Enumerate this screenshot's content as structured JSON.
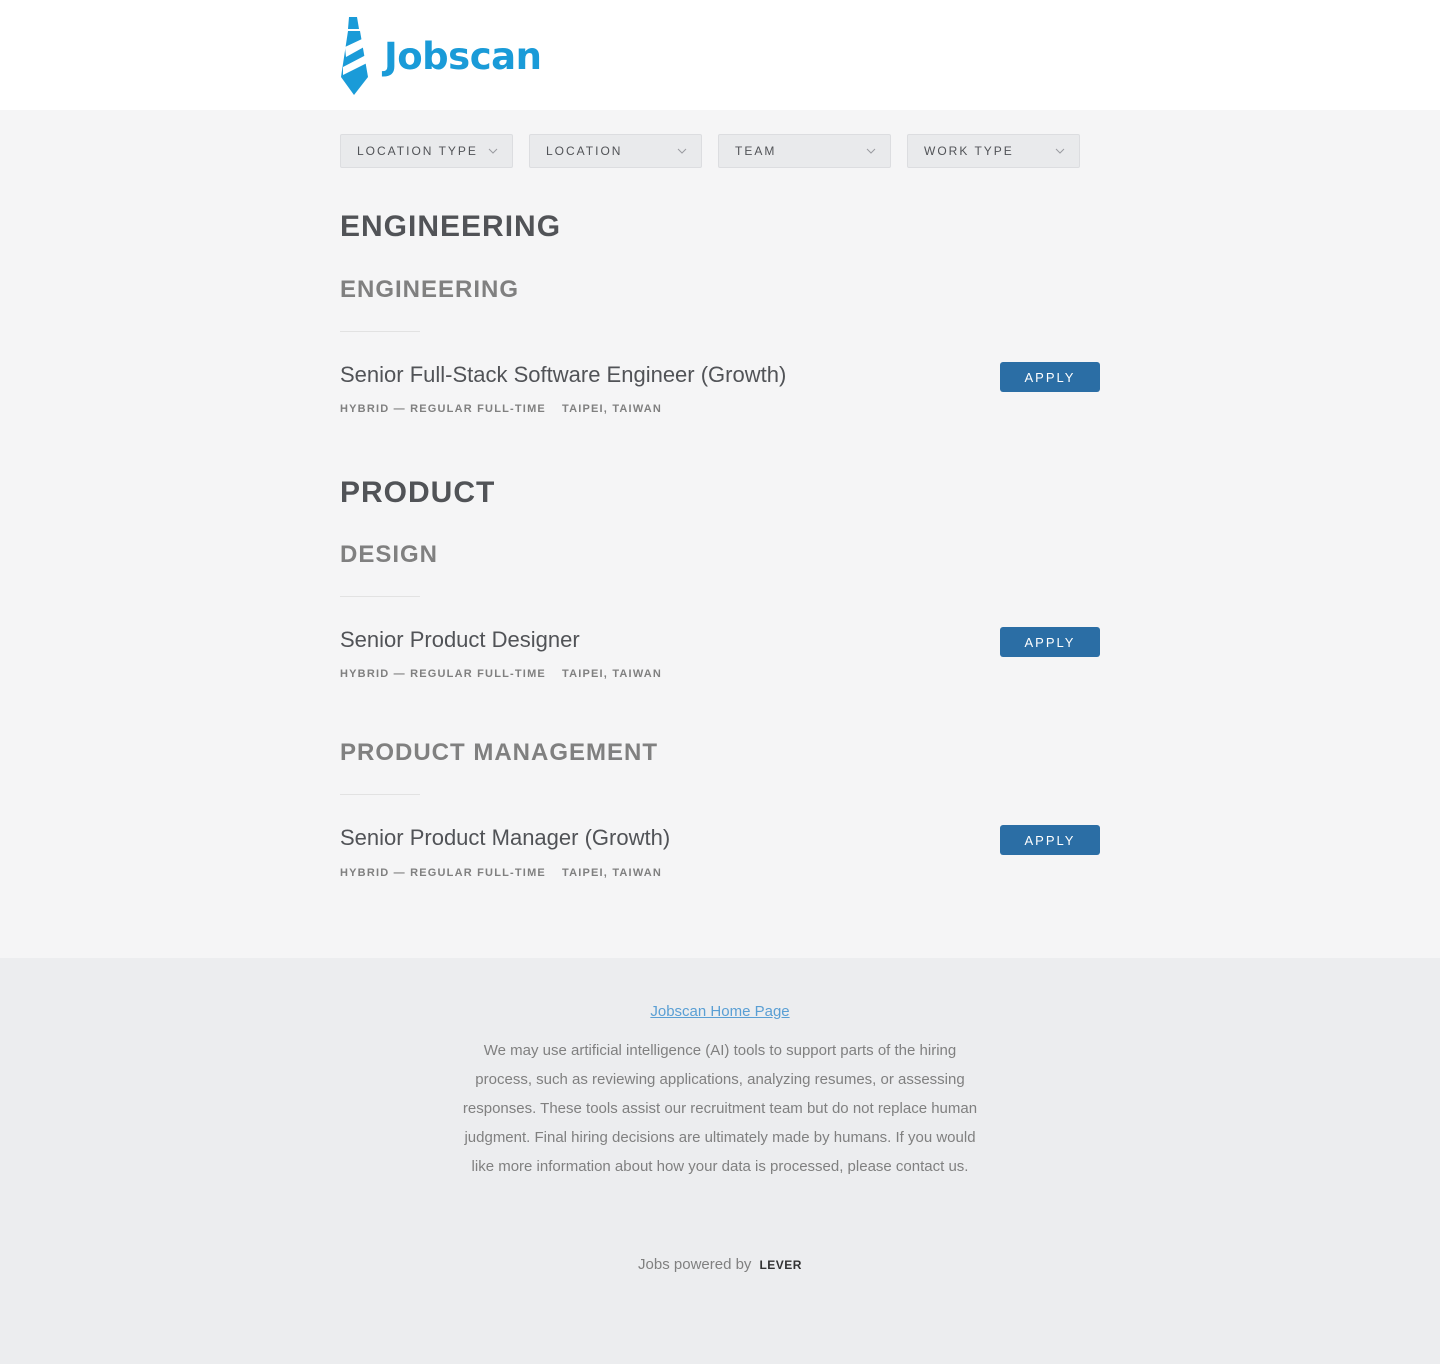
{
  "header": {
    "brand": "Jobscan",
    "accent": "#1a9bd8"
  },
  "filters": [
    {
      "label": "LOCATION TYPE"
    },
    {
      "label": "LOCATION"
    },
    {
      "label": "TEAM"
    },
    {
      "label": "WORK TYPE"
    }
  ],
  "departments": [
    {
      "name": "ENGINEERING",
      "teams": [
        {
          "name": "ENGINEERING",
          "jobs": [
            {
              "title": "Senior Full-Stack Software Engineer (Growth)",
              "commitment": "HYBRID — REGULAR FULL-TIME",
              "location": "TAIPEI, TAIWAN",
              "apply_label": "APPLY"
            }
          ]
        }
      ]
    },
    {
      "name": "PRODUCT",
      "teams": [
        {
          "name": "DESIGN",
          "jobs": [
            {
              "title": "Senior Product Designer",
              "commitment": "HYBRID — REGULAR FULL-TIME",
              "location": "TAIPEI, TAIWAN",
              "apply_label": "APPLY"
            }
          ]
        },
        {
          "name": "PRODUCT MANAGEMENT",
          "jobs": [
            {
              "title": "Senior Product Manager (Growth)",
              "commitment": "HYBRID — REGULAR FULL-TIME",
              "location": "TAIPEI, TAIWAN",
              "apply_label": "APPLY"
            }
          ]
        }
      ]
    }
  ],
  "footer": {
    "home_link": "Jobscan Home Page",
    "disclaimer": "We may use artificial intelligence (AI) tools to support parts of the hiring process, such as reviewing applications, analyzing resumes, or assessing responses. These tools assist our recruitment team but do not replace human judgment. Final hiring decisions are ultimately made by humans. If you would like more information about how your data is processed, please contact us.",
    "powered_by": "Jobs powered by",
    "lever": "LEVER"
  },
  "colors": {
    "apply": "#2b6ea5",
    "link": "#5a9fd4"
  }
}
